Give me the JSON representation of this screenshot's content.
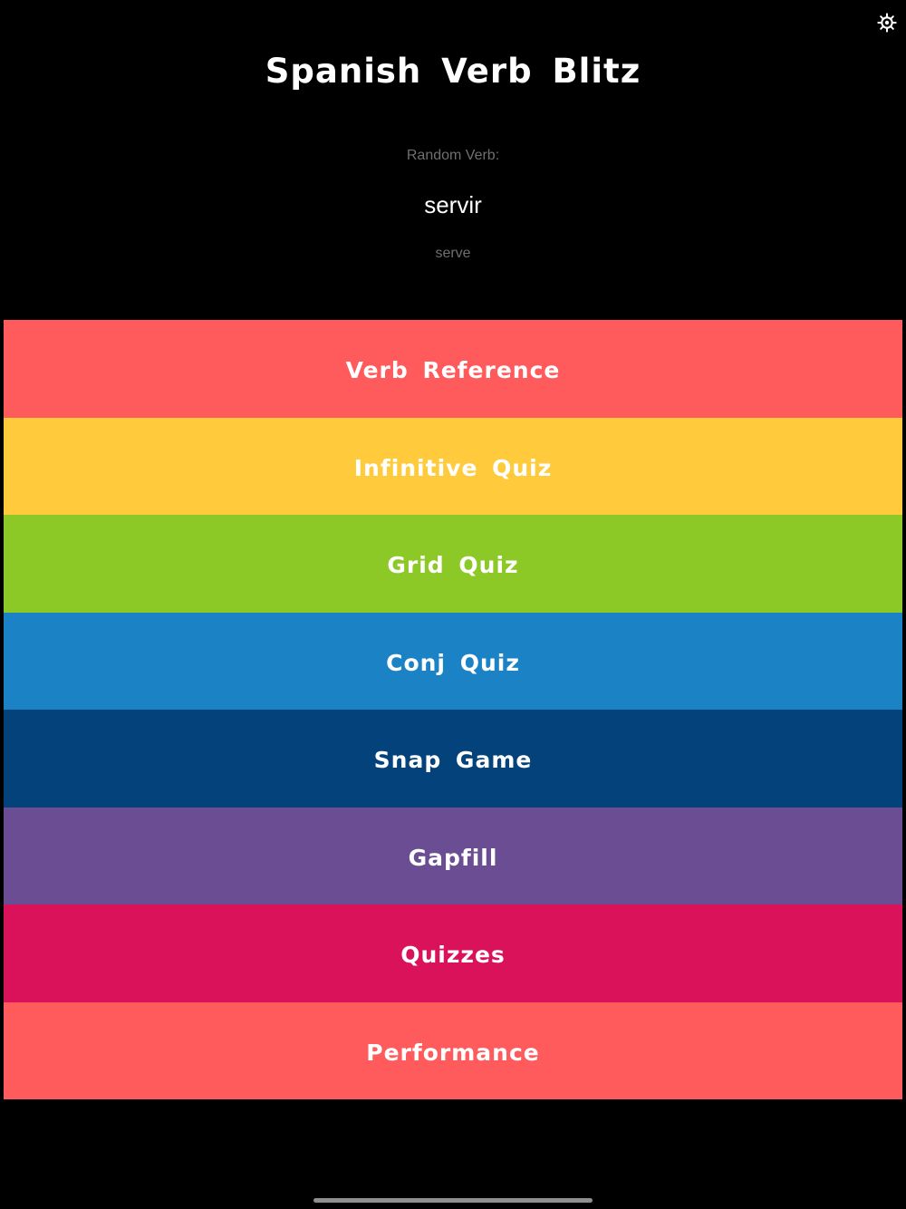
{
  "header": {
    "title": "Spanish Verb Blitz",
    "settings_icon": "gear-icon"
  },
  "random_verb": {
    "label": "Random Verb:",
    "verb": "servir",
    "translation": "serve"
  },
  "menu": {
    "items": [
      {
        "label": "Verb Reference",
        "color": "#FF5A5C"
      },
      {
        "label": "Infinitive Quiz",
        "color": "#FFCB3D"
      },
      {
        "label": "Grid Quiz",
        "color": "#8CC927"
      },
      {
        "label": "Conj Quiz",
        "color": "#1B82C5"
      },
      {
        "label": "Snap Game",
        "color": "#03427A"
      },
      {
        "label": "Gapfill",
        "color": "#6B4D93"
      },
      {
        "label": "Quizzes",
        "color": "#D91259"
      },
      {
        "label": "Performance",
        "color": "#FF5A5C"
      }
    ]
  },
  "colors": {
    "background": "#000000",
    "muted_text": "#6F6F6F",
    "text": "#FFFFFF"
  }
}
